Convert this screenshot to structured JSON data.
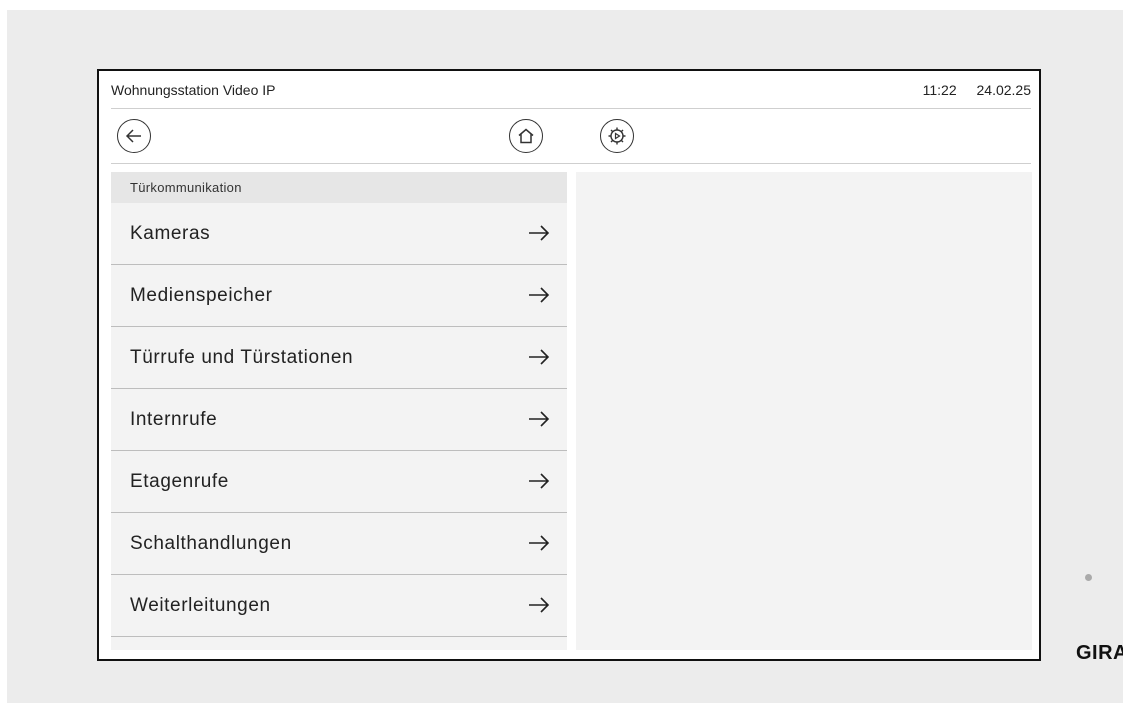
{
  "statusbar": {
    "title": "Wohnungsstation Video IP",
    "time": "11:22",
    "date": "24.02.25"
  },
  "toolbar": {
    "back_icon": "arrow-left-icon",
    "home_icon": "home-icon",
    "settings_icon": "gear-icon"
  },
  "menu": {
    "header": "Türkommunikation",
    "items": [
      {
        "label": "Kameras"
      },
      {
        "label": "Medienspeicher"
      },
      {
        "label": "Türrufe und Türstationen"
      },
      {
        "label": "Internrufe"
      },
      {
        "label": "Etagenrufe"
      },
      {
        "label": "Schalthandlungen"
      },
      {
        "label": "Weiterleitungen"
      }
    ]
  },
  "brand": "GIRA",
  "colors": {
    "frame": "#ececec",
    "panel": "#f3f3f3",
    "border": "#111111"
  }
}
